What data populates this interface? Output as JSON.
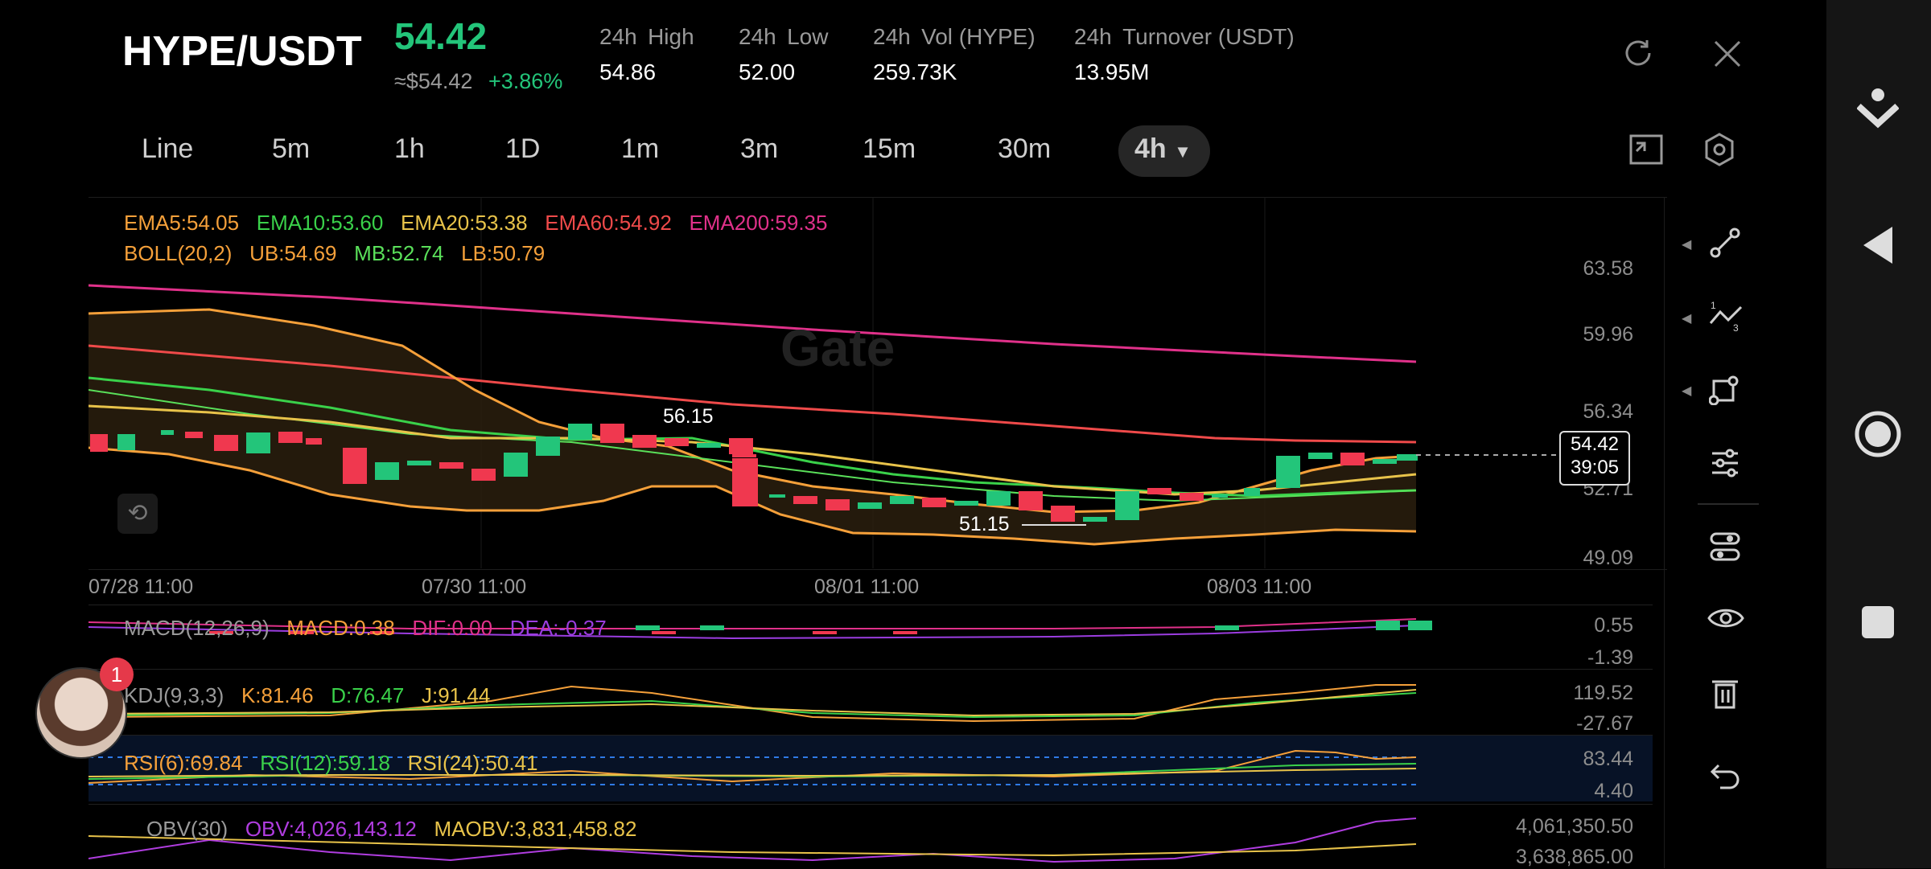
{
  "header": {
    "pair": "HYPE/USDT",
    "price": "54.42",
    "usd_price": "≈$54.42",
    "change": "+3.86%",
    "stats": [
      {
        "k1": "24h",
        "k2": "High",
        "v": "54.86"
      },
      {
        "k1": "24h",
        "k2": "Low",
        "v": "52.00"
      },
      {
        "k1": "24h",
        "k2": "Vol (HYPE)",
        "v": "259.73K"
      },
      {
        "k1": "24h",
        "k2": "Turnover (USDT)",
        "v": "13.95M"
      }
    ]
  },
  "timeframes": [
    "Line",
    "5m",
    "1h",
    "1D",
    "1m",
    "3m",
    "15m",
    "30m",
    "4h"
  ],
  "active_timeframe": "4h",
  "indicators": {
    "ema": [
      "EMA5:54.05",
      "EMA10:53.60",
      "EMA20:53.38",
      "EMA60:54.92",
      "EMA200:59.35"
    ],
    "boll": [
      "BOLL(20,2)",
      "UB:54.69",
      "MB:52.74",
      "LB:50.79"
    ],
    "macd": [
      "MACD(12,26,9)",
      "MACD:0.38",
      "DIF:0.00",
      "DEA:-0.37"
    ],
    "kdj": [
      "KDJ(9,3,3)",
      "K:81.46",
      "D:76.47",
      "J:91.44"
    ],
    "rsi": [
      "RSI(6):69.84",
      "RSI(12):59.18",
      "RSI(24):50.41"
    ],
    "obv": [
      "OBV(30)",
      "OBV:4,026,143.12",
      "MAOBV:3,831,458.82"
    ]
  },
  "price_axis": [
    "63.58",
    "59.96",
    "56.34",
    "52.71",
    "49.09"
  ],
  "macd_axis": [
    "0.55",
    "-1.39"
  ],
  "kdj_axis": [
    "119.52",
    "-27.67"
  ],
  "rsi_axis": [
    "83.44",
    "4.40"
  ],
  "obv_axis": [
    "4,061,350.50",
    "3,638,865.00"
  ],
  "dates": [
    "07/28 11:00",
    "07/30 11:00",
    "08/01 11:00",
    "08/03 11:00"
  ],
  "annotations": {
    "high": "56.15",
    "low": "51.15"
  },
  "current_tag": {
    "price": "54.42",
    "countdown": "39:05"
  },
  "watermark": "Gate",
  "notification_count": "1",
  "colors": {
    "up": "#23c57a",
    "down": "#f0384f",
    "accent": "#23c57a"
  }
}
